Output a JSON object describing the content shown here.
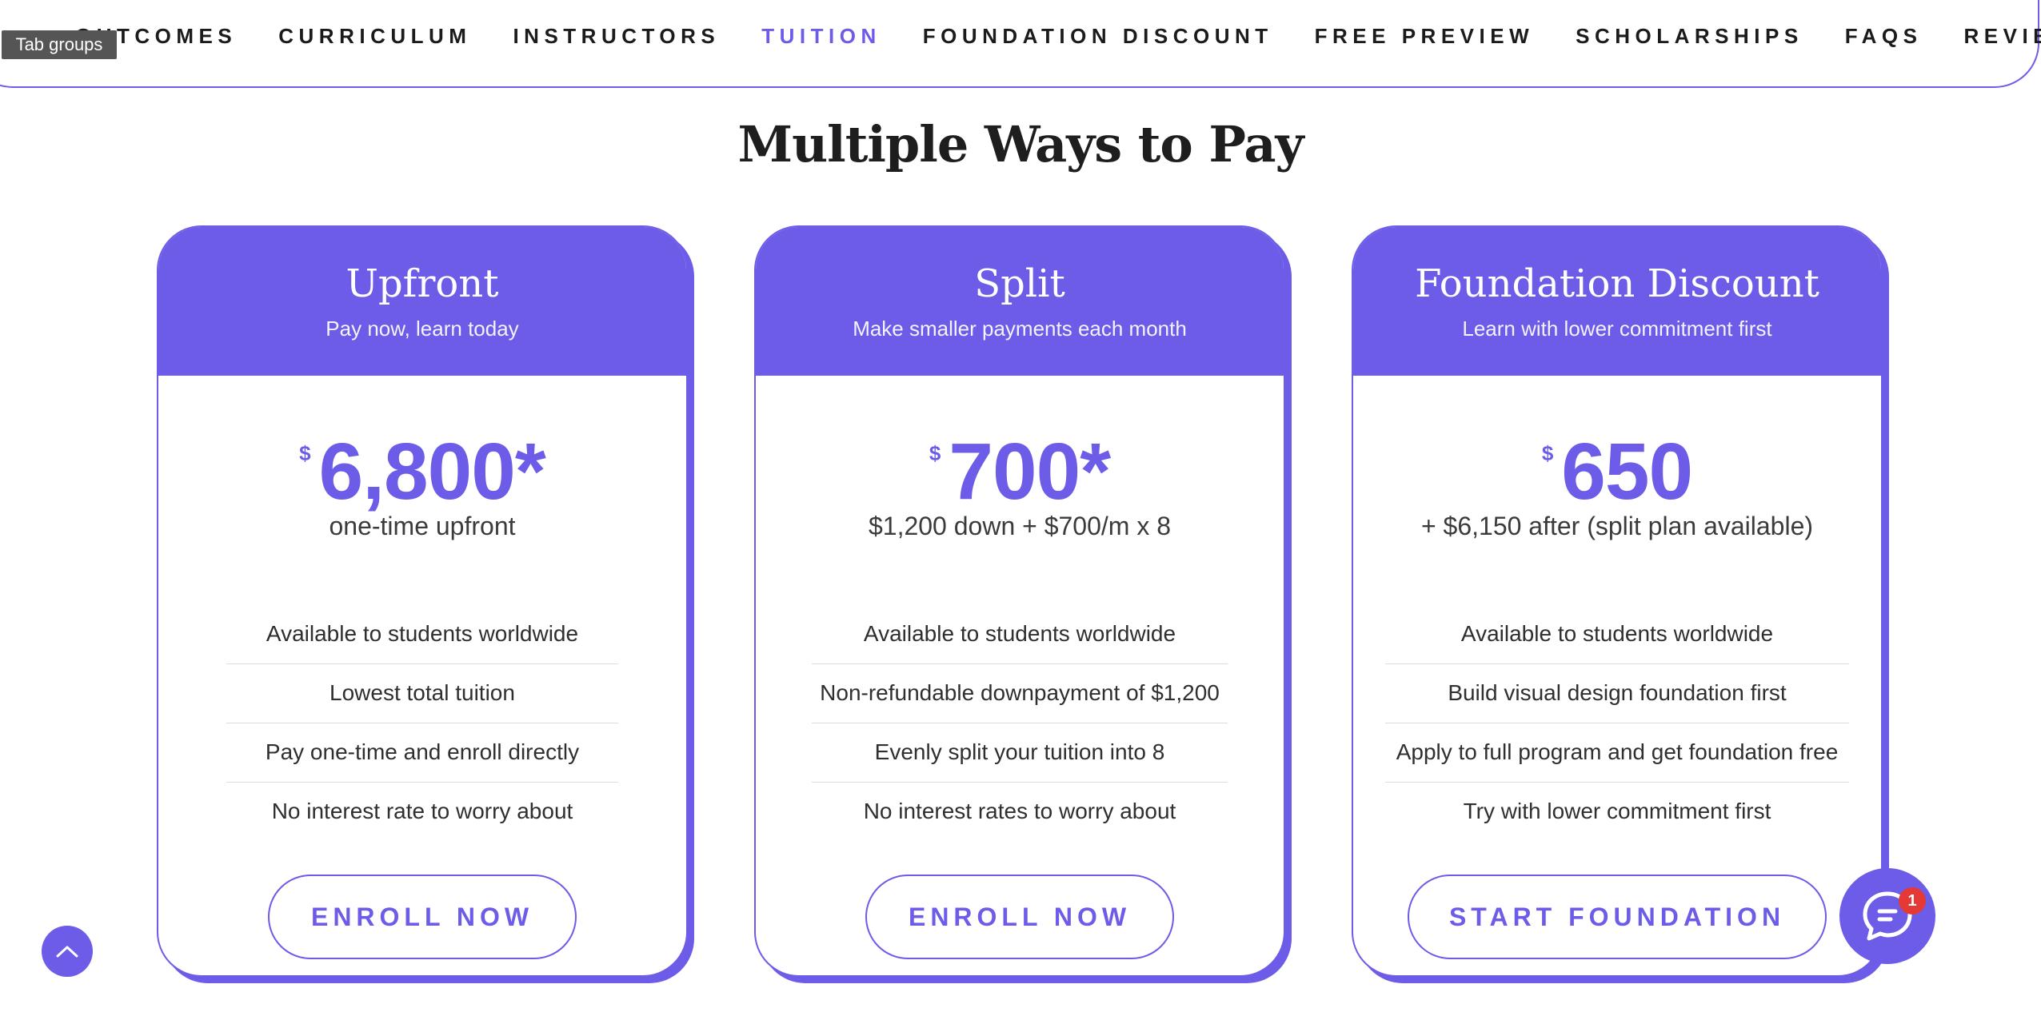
{
  "nav": {
    "items": [
      {
        "label": "OUTCOMES"
      },
      {
        "label": "CURRICULUM"
      },
      {
        "label": "INSTRUCTORS"
      },
      {
        "label": "TUITION"
      },
      {
        "label": "FOUNDATION DISCOUNT"
      },
      {
        "label": "FREE PREVIEW"
      },
      {
        "label": "SCHOLARSHIPS"
      },
      {
        "label": "FAQS"
      },
      {
        "label": "REVIEWS"
      }
    ],
    "active": "TUITION"
  },
  "tooltip": "Tab groups",
  "page_title": "Multiple Ways to Pay",
  "plans": [
    {
      "title": "Upfront",
      "subtitle": "Pay now, learn today",
      "currency": "$",
      "amount": "6,800*",
      "note": "one-time upfront",
      "features": [
        "Available to students worldwide",
        "Lowest total tuition",
        "Pay one-time and enroll directly",
        "No interest rate to worry about"
      ],
      "cta": "ENROLL NOW"
    },
    {
      "title": "Split",
      "subtitle": "Make smaller payments each month",
      "currency": "$",
      "amount": "700*",
      "note": "$1,200 down + $700/m x 8",
      "features": [
        "Available to students worldwide",
        "Non-refundable downpayment of $1,200",
        "Evenly split your tuition into 8",
        "No interest rates to worry about"
      ],
      "cta": "ENROLL NOW"
    },
    {
      "title": "Foundation Discount",
      "subtitle": "Learn with lower commitment first",
      "currency": "$",
      "amount": "650",
      "note": "+ $6,150 after (split plan available)",
      "features": [
        "Available to students worldwide",
        "Build visual design foundation first",
        "Apply to full program and get foundation free",
        "Try with lower commitment first"
      ],
      "cta": "START FOUNDATION"
    }
  ],
  "chat": {
    "badge": "1"
  },
  "colors": {
    "accent": "#6c5ce7",
    "badge": "#e53935",
    "tooltip_bg": "#555555"
  }
}
